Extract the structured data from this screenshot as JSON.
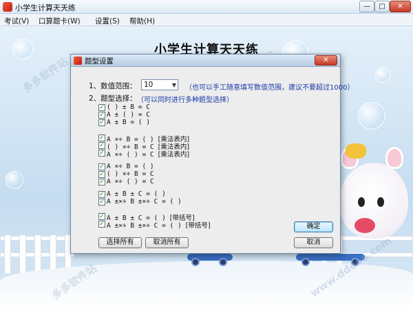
{
  "window": {
    "title": "小学生计算天天练",
    "min": "—",
    "max": "□",
    "close": "✕"
  },
  "menu": [
    "考试(V)",
    "口算题卡(W)",
    "设置(S)",
    "帮助(H)"
  ],
  "scene": {
    "title": "小学生计算天天练",
    "watermark": "多多软件站",
    "watermark2": "www.ddooo.com"
  },
  "dialog": {
    "title": "题型设置",
    "close": "✕",
    "range_label": "1、数值范围：",
    "range_value": "10",
    "range_hint": "（也可以手工随意填写数值范围，建议不要超过1000）",
    "type_label": "2、题型选择：",
    "type_hint": "（可以同时进行多种题型选择）",
    "groups": [
      [
        {
          "text": "(  ) ± B = C",
          "checked": true
        },
        {
          "text": "A ± (  ) = C",
          "checked": true
        },
        {
          "text": "A ± B = (  )",
          "checked": true
        }
      ],
      [
        {
          "text": "A ×÷ B = (  )",
          "note": "[乘法表内]",
          "checked": true
        },
        {
          "text": "(  ) ×÷ B = C",
          "note": "[乘法表内]",
          "checked": true
        },
        {
          "text": "A ×÷ (  ) = C",
          "note": "[乘法表内]",
          "checked": true
        }
      ],
      [
        {
          "text": "A ×÷ B = (  )",
          "checked": true
        },
        {
          "text": "(  ) ×÷ B = C",
          "checked": true
        },
        {
          "text": "A ×÷ (  ) = C",
          "checked": true
        }
      ],
      [
        {
          "text": "A ± B ± C = (  )",
          "checked": true
        },
        {
          "text": "A ±×÷ B ±×÷ C = (  )",
          "checked": true
        }
      ],
      [
        {
          "text": "A ± B ± C = (  )",
          "note": "[带括号]",
          "checked": true
        },
        {
          "text": "A ±×÷ B ±×÷ C = (  )",
          "note": "[带括号]",
          "checked": true
        }
      ]
    ],
    "buttons": {
      "select_all": "选择所有",
      "deselect_all": "取消所有",
      "ok": "确定",
      "cancel": "取消"
    },
    "check_glyph": "✓",
    "arrow_glyph": "▼"
  }
}
